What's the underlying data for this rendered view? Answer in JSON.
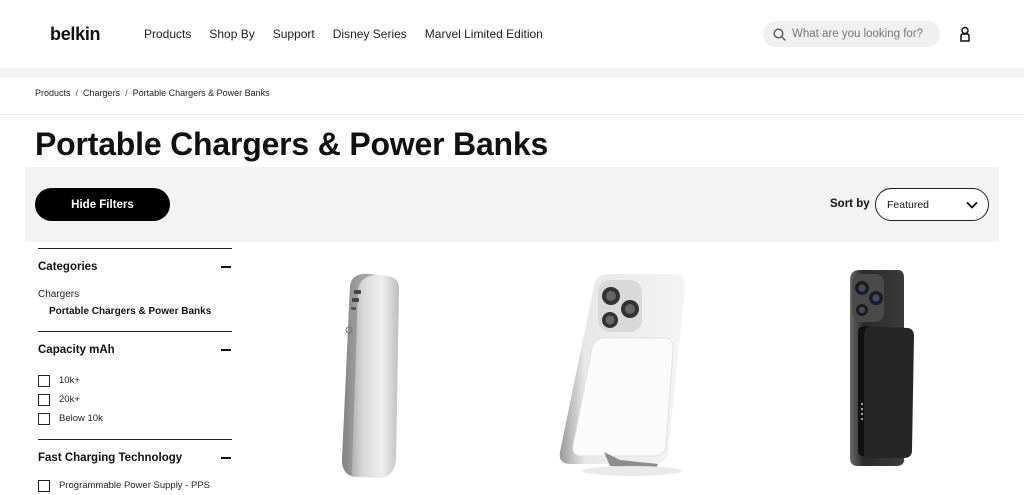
{
  "header": {
    "logo": "belkin",
    "nav": [
      "Products",
      "Shop By",
      "Support",
      "Disney Series",
      "Marvel Limited Edition"
    ],
    "search_placeholder": "What are you looking for?"
  },
  "breadcrumb": [
    "Products",
    "Chargers",
    "Portable Chargers & Power Banks"
  ],
  "page_title": "Portable Chargers & Power Banks",
  "filter_bar": {
    "hide_filters_label": "Hide Filters",
    "sort_label": "Sort by",
    "sort_value": "Featured"
  },
  "sidebar": {
    "categories": {
      "title": "Categories",
      "parent": "Chargers",
      "child": "Portable Chargers & Power Banks"
    },
    "capacity": {
      "title": "Capacity mAh",
      "options": [
        "10k+",
        "20k+",
        "Below 10k"
      ]
    },
    "fast_charging": {
      "title": "Fast Charging Technology",
      "options": [
        "Programmable Power Supply - PPS"
      ]
    }
  },
  "colors": {
    "accent": "#000000",
    "band": "#f3f3f3"
  }
}
